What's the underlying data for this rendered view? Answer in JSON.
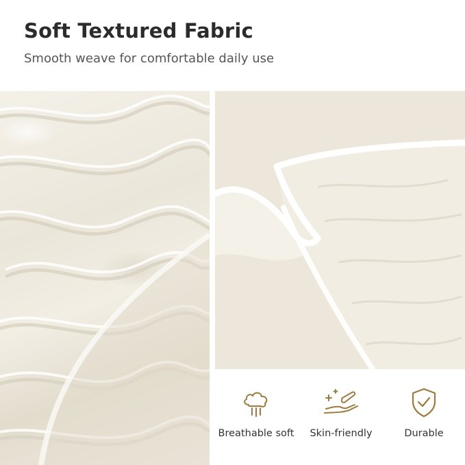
{
  "header": {
    "title": "Soft Textured Fabric",
    "subtitle": "Smooth weave for comfortable daily use"
  },
  "features": [
    {
      "icon": "cloud-breathable-icon",
      "label": "Breathable soft"
    },
    {
      "icon": "hand-sparkle-icon",
      "label": "Skin-friendly"
    },
    {
      "icon": "shield-check-icon",
      "label": "Durable"
    }
  ],
  "colors": {
    "fabric": "#efebe1",
    "icon_gold": "#9b7a3c",
    "title": "#2b2b2b"
  }
}
